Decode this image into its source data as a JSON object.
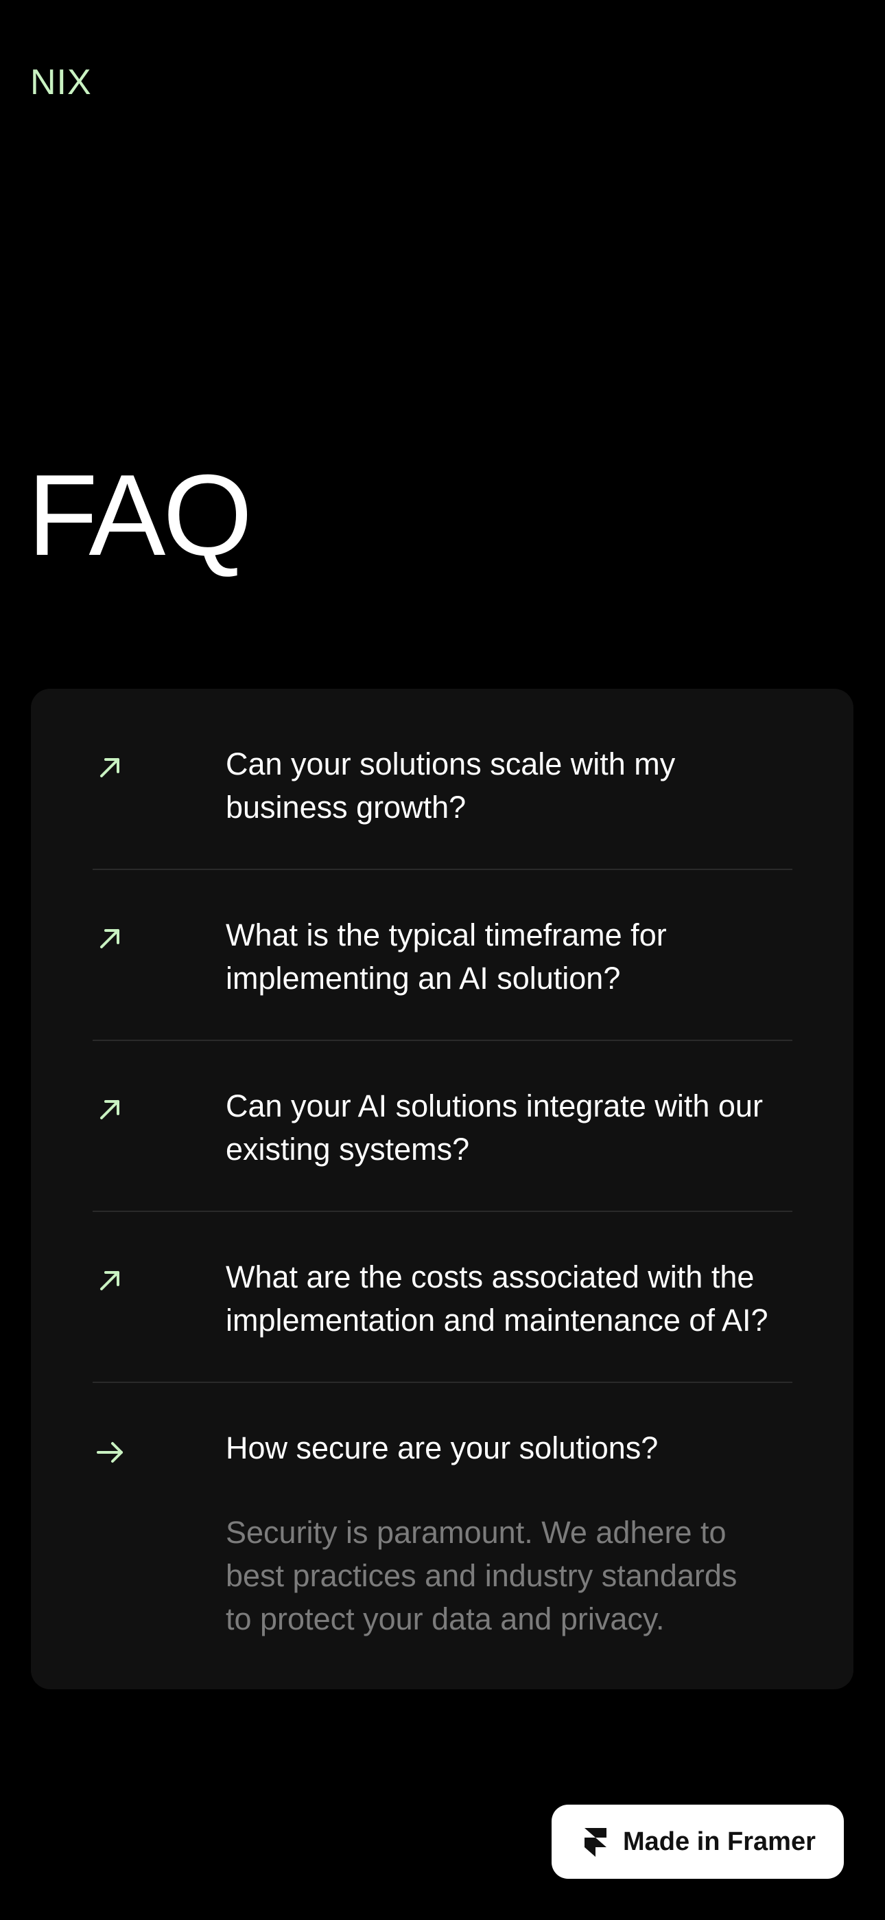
{
  "header": {
    "logo_text": "NIX"
  },
  "page": {
    "title": "FAQ"
  },
  "faq": {
    "items": [
      {
        "question_line1": "Can your solutions scale with my",
        "question_line2": "business growth?",
        "icon": "arrow-up-right-icon",
        "expanded": false
      },
      {
        "question_line1": "What is the typical timeframe for",
        "question_line2": "implementing an AI solution?",
        "icon": "arrow-up-right-icon",
        "expanded": false
      },
      {
        "question_line1": "Can your AI solutions integrate with our",
        "question_line2": "existing systems?",
        "icon": "arrow-up-right-icon",
        "expanded": false
      },
      {
        "question_line1": "What are the costs associated with the",
        "question_line2": "implementation and maintenance of AI?",
        "icon": "arrow-up-right-icon",
        "expanded": false
      },
      {
        "question_line1": "How secure are your solutions?",
        "question_line2": "",
        "icon": "arrow-right-icon",
        "expanded": true,
        "answer_line1": "Security is paramount. We adhere to",
        "answer_line2": "best practices and industry standards",
        "answer_line3": "to protect your data and privacy."
      }
    ]
  },
  "badge": {
    "label": "Made in Framer",
    "icon": "framer-logo-icon"
  },
  "colors": {
    "background": "#000000",
    "card": "#111111",
    "accent": "#c9f2c2",
    "text": "#ffffff",
    "muted": "#7c7c7c",
    "divider": "#2a2a2a"
  }
}
